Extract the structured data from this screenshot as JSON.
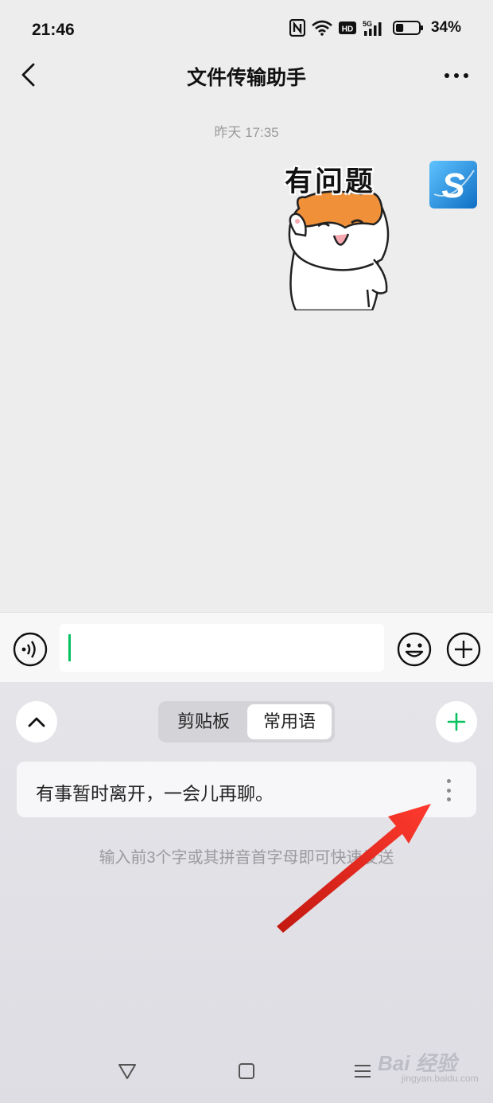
{
  "status_bar": {
    "time": "21:46",
    "icons": [
      "nfc-icon",
      "wifi-icon",
      "hd-icon",
      "5g-signal-icon",
      "battery-icon"
    ],
    "hd_label": "HD",
    "network_label": "5G",
    "battery_percent": "34%",
    "battery_level": 0.34
  },
  "header": {
    "title": "文件传输助手",
    "back_icon": "chevron-left-icon",
    "more_icon": "more-dots-icon"
  },
  "chat": {
    "timestamp": "昨天 17:35",
    "message": {
      "type": "sticker",
      "sticker_caption": "有问题",
      "avatar_letter": "S",
      "avatar_color": "#1e8fd8"
    }
  },
  "input_bar": {
    "voice_icon": "voice-icon",
    "input_value": "",
    "emoji_icon": "emoji-icon",
    "plus_icon": "plus-circle-icon",
    "accent_color": "#07c160"
  },
  "panel": {
    "collapse_icon": "chevron-up-icon",
    "tabs": [
      {
        "label": "剪贴板",
        "selected": false
      },
      {
        "label": "常用语",
        "selected": true
      }
    ],
    "add_icon": "plus-icon",
    "phrases": [
      {
        "text": "有事暂时离开，一会儿再聊。"
      }
    ],
    "hint": "输入前3个字或其拼音首字母即可快速发送"
  },
  "annotation": {
    "type": "red-arrow",
    "color": "#e8261f"
  },
  "nav_bar": {
    "icons": [
      "back-triangle-icon",
      "home-square-icon",
      "recents-menu-icon"
    ]
  },
  "watermark": {
    "brand": "Bai 经验",
    "url": "jingyan.baidu.com"
  }
}
